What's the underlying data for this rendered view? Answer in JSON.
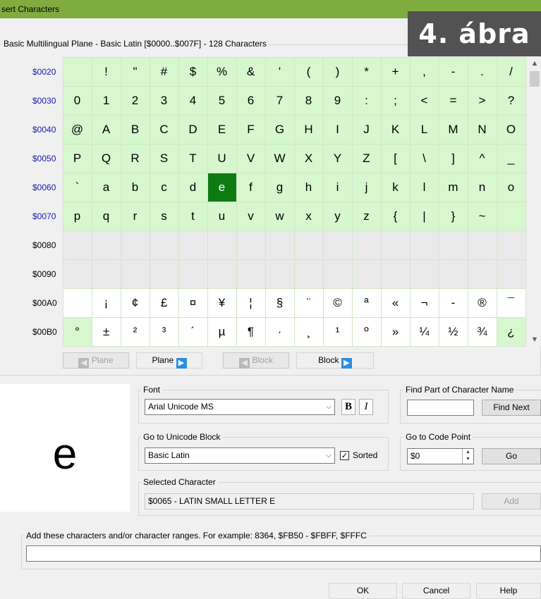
{
  "window": {
    "title": "sert Characters"
  },
  "overlay_badge": "4. ábra",
  "plane_group_label": "Basic Multilingual Plane - Basic Latin [$0000..$007F] - 128 Characters",
  "grid": {
    "rows": [
      {
        "code": "$0020",
        "chars": [
          "",
          "!",
          "\"",
          "#",
          "$",
          "%",
          "&",
          "'",
          "(",
          ")",
          "*",
          "+",
          ",",
          "-",
          ".",
          "/"
        ]
      },
      {
        "code": "$0030",
        "chars": [
          "0",
          "1",
          "2",
          "3",
          "4",
          "5",
          "6",
          "7",
          "8",
          "9",
          ":",
          ";",
          "<",
          "=",
          ">",
          "?"
        ]
      },
      {
        "code": "$0040",
        "chars": [
          "@",
          "A",
          "B",
          "C",
          "D",
          "E",
          "F",
          "G",
          "H",
          "I",
          "J",
          "K",
          "L",
          "M",
          "N",
          "O"
        ]
      },
      {
        "code": "$0050",
        "chars": [
          "P",
          "Q",
          "R",
          "S",
          "T",
          "U",
          "V",
          "W",
          "X",
          "Y",
          "Z",
          "[",
          "\\",
          "]",
          "^",
          "_"
        ]
      },
      {
        "code": "$0060",
        "chars": [
          "`",
          "a",
          "b",
          "c",
          "d",
          "e",
          "f",
          "g",
          "h",
          "i",
          "j",
          "k",
          "l",
          "m",
          "n",
          "o"
        ]
      },
      {
        "code": "$0070",
        "chars": [
          "p",
          "q",
          "r",
          "s",
          "t",
          "u",
          "v",
          "w",
          "x",
          "y",
          "z",
          "{",
          "|",
          "}",
          "~",
          ""
        ]
      },
      {
        "code": "$0080",
        "chars": [
          "",
          "",
          "",
          "",
          "",
          "",
          "",
          "",
          "",
          "",
          "",
          "",
          "",
          "",
          "",
          ""
        ]
      },
      {
        "code": "$0090",
        "chars": [
          "",
          "",
          "",
          "",
          "",
          "",
          "",
          "",
          "",
          "",
          "",
          "",
          "",
          "",
          "",
          ""
        ]
      },
      {
        "code": "$00A0",
        "chars": [
          "",
          "¡",
          "¢",
          "£",
          "¤",
          "¥",
          "¦",
          "§",
          "¨",
          "©",
          "ª",
          "«",
          "¬",
          "-",
          "®",
          "¯"
        ]
      },
      {
        "code": "$00B0",
        "chars": [
          "°",
          "±",
          "²",
          "³",
          "´",
          "µ",
          "¶",
          "·",
          "¸",
          "¹",
          "º",
          "»",
          "¼",
          "½",
          "¾",
          "¿"
        ]
      }
    ],
    "selected": "e"
  },
  "nav": {
    "plane_prev": "Plane",
    "plane_next": "Plane",
    "block_prev": "Block",
    "block_next": "Block"
  },
  "preview_char": "e",
  "font": {
    "group_label": "Font",
    "value": "Arial Unicode MS",
    "bold_label": "B",
    "italic_label": "I"
  },
  "find": {
    "group_label": "Find Part of Character Name",
    "value": "",
    "button": "Find Next"
  },
  "unicode_block": {
    "group_label": "Go to Unicode Block",
    "value": "Basic Latin",
    "sorted_label": "Sorted",
    "sorted_checked": true
  },
  "code_point": {
    "group_label": "Go to Code Point",
    "value": "$0",
    "button": "Go"
  },
  "selected_character": {
    "group_label": "Selected Character",
    "value": "$0065 - LATIN SMALL LETTER E"
  },
  "add_button": "Add",
  "ranges": {
    "label": "Add these characters and/or character ranges. For example: 8364, $FB50 - $FBFF, $FFFC",
    "value": ""
  },
  "footer": {
    "ok": "OK",
    "cancel": "Cancel",
    "help": "Help"
  }
}
